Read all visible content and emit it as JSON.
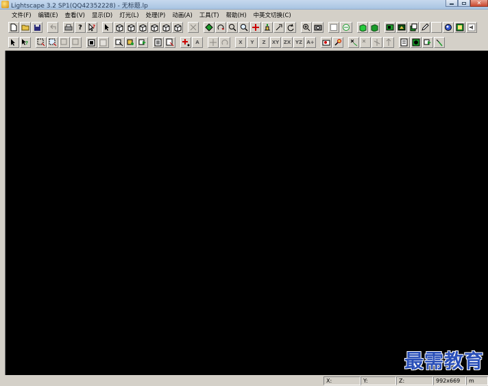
{
  "window": {
    "title": "Lightscape 3.2 SP1(QQ42352228) - 无标题.lp",
    "minimize_glyph": "",
    "maximize_glyph": "",
    "close_glyph": "✕"
  },
  "menu": [
    {
      "label": "文件(F)"
    },
    {
      "label": "编辑(E)"
    },
    {
      "label": "查看(V)"
    },
    {
      "label": "显示(D)"
    },
    {
      "label": "灯光(L)"
    },
    {
      "label": "处理(P)"
    },
    {
      "label": "动画(A)"
    },
    {
      "label": "工具(T)"
    },
    {
      "label": "帮助(H)"
    },
    {
      "label": "中英文切换(C)"
    }
  ],
  "toolbar_axis_labels": {
    "x": "X",
    "y": "Y",
    "z": "Z",
    "xy": "XY",
    "zx": "ZX",
    "yz": "YZ",
    "arrow": "A+"
  },
  "status": {
    "x_label": "X:",
    "y_label": "Y:",
    "z_label": "Z:",
    "resolution": "992x669",
    "unit": "m"
  },
  "watermark": "最需教育",
  "colors": {
    "viewport_bg": "#000000",
    "chrome_bg": "#d4d0c8",
    "watermark": "#2a4fb8"
  }
}
